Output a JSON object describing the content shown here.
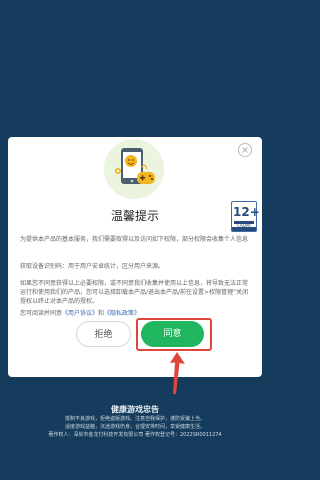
{
  "dialog": {
    "title": "温馨提示",
    "paragraph_1": "为提供本产品的基本服务，我们需要取得以及访问如下权限，部分权限会收集个人信息",
    "paragraph_2": "获取设备识别码：用于用户安卓统计，区分用户来源。",
    "paragraph_3": "如果您不同意获得以上必要权限，或不同意我们收集并使用以上信息，将导致无法正常运行和使用我们的产品，您可以选择卸载本产品/退出本产品/前往设置>权限管理”关闭授权以终止对本产品的授权。",
    "read_prefix": "您可阅读并同意",
    "user_agreement": "《用户协议》",
    "and": "和",
    "privacy_policy": "《隐私政策》",
    "age_rating": "12+",
    "age_rating_org": "CADPA",
    "age_rating_caption": "适龄提示",
    "reject_label": "拒绝",
    "agree_label": "同意",
    "close_icon": "close-icon",
    "hero_icon": "phone-controller-icon"
  },
  "notice": {
    "title": "健康游戏忠告",
    "line_1": "抵制不良游戏，拒绝盗版游戏。注意自我保护，谨防受骗上当。",
    "line_2": "适度游戏益脑，沉迷游戏伤身。合理安排时间，享受健康生活。",
    "line_3": "著作权人：深圳市金龙付科技开发有限公司 著作权登记号：2022SR0011274"
  },
  "colors": {
    "background": "#153c5c",
    "agree_green": "#1fb65f",
    "highlight_red": "#e0453b",
    "link_blue": "#3a68b6"
  }
}
